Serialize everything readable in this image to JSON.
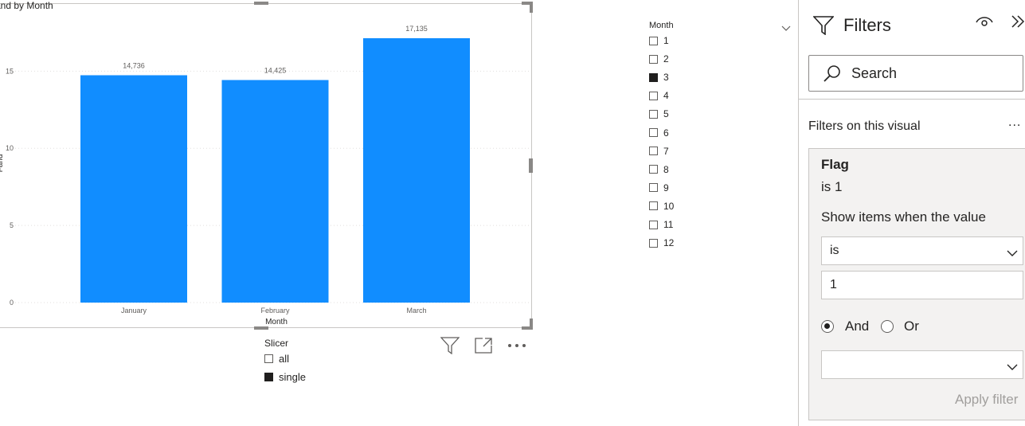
{
  "chart": {
    "title": "and by Month",
    "ylabel": "Fand",
    "xlabel": "Month"
  },
  "chart_data": {
    "type": "bar",
    "title": "and by Month",
    "xlabel": "Month",
    "ylabel": "Fand",
    "categories": [
      "January",
      "February",
      "March"
    ],
    "values": [
      14.736,
      14.425,
      17.135
    ],
    "data_labels": [
      "14,736",
      "14,425",
      "17,135"
    ],
    "ylim": [
      0,
      17.135
    ],
    "yticks": [
      "0",
      "5",
      "10",
      "15"
    ],
    "grid": true,
    "bar_color": "#118dff"
  },
  "visual_header": {
    "filter_icon": "filter-icon",
    "focus_icon": "focus-mode-icon",
    "more_icon": "more-options-icon"
  },
  "month_slicer": {
    "title": "Month",
    "items": [
      {
        "label": "1",
        "checked": false
      },
      {
        "label": "2",
        "checked": false
      },
      {
        "label": "3",
        "checked": true
      },
      {
        "label": "4",
        "checked": false
      },
      {
        "label": "5",
        "checked": false
      },
      {
        "label": "6",
        "checked": false
      },
      {
        "label": "7",
        "checked": false
      },
      {
        "label": "8",
        "checked": false
      },
      {
        "label": "9",
        "checked": false
      },
      {
        "label": "10",
        "checked": false
      },
      {
        "label": "11",
        "checked": false
      },
      {
        "label": "12",
        "checked": false
      }
    ]
  },
  "slicer": {
    "title": "Slicer",
    "items": [
      {
        "label": "all",
        "checked": false
      },
      {
        "label": "single",
        "checked": true
      }
    ]
  },
  "filters_pane": {
    "title": "Filters",
    "search_placeholder": "Search",
    "section_label": "Filters on this visual",
    "more": "...",
    "card": {
      "field": "Flag",
      "summary": "is 1",
      "show_items_label": "Show items when the value",
      "operator": "is",
      "value": "1",
      "and_label": "And",
      "or_label": "Or",
      "logic_selected": "And",
      "second_operator": "",
      "apply_label": "Apply filter"
    }
  }
}
